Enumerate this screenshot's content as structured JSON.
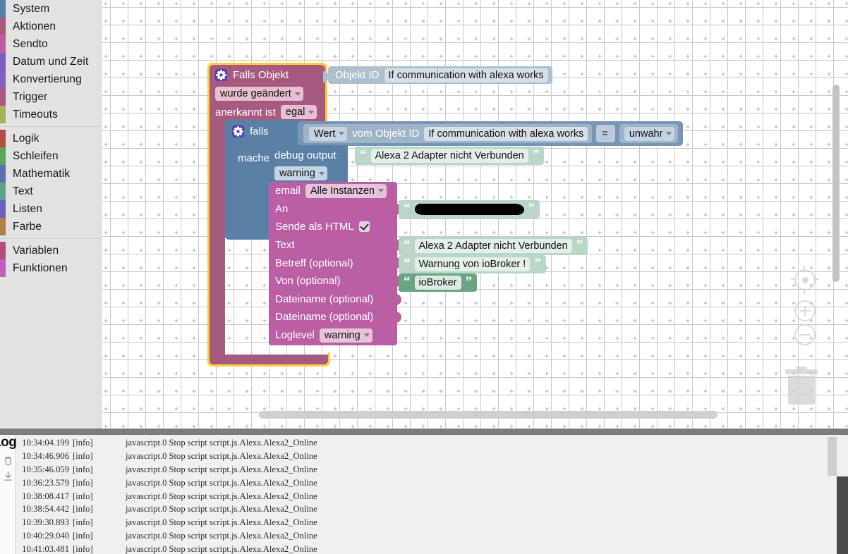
{
  "toolbox": {
    "groups": [
      {
        "items": [
          {
            "label": "System",
            "color": "#5b80a5"
          },
          {
            "label": "Aktionen",
            "color": "#a75a7f"
          },
          {
            "label": "Sendto",
            "color": "#ba5fa3"
          },
          {
            "label": "Datum und Zeit",
            "color": "#7d5fc0"
          },
          {
            "label": "Konvertierung",
            "color": "#8a5fc0"
          },
          {
            "label": "Trigger",
            "color": "#a75a7f"
          },
          {
            "label": "Timeouts",
            "color": "#a8b05a"
          }
        ]
      },
      {
        "items": [
          {
            "label": "Logik",
            "color": "#b04f44"
          },
          {
            "label": "Schleifen",
            "color": "#5ba55b"
          },
          {
            "label": "Mathematik",
            "color": "#5a72b0"
          },
          {
            "label": "Text",
            "color": "#5ba58d"
          },
          {
            "label": "Listen",
            "color": "#6b5fc0"
          },
          {
            "label": "Farbe",
            "color": "#b07f4a"
          }
        ]
      },
      {
        "items": [
          {
            "label": "Variablen",
            "color": "#b0507f"
          },
          {
            "label": "Funktionen",
            "color": "#c05fc0"
          }
        ]
      }
    ]
  },
  "workspace": {
    "selected_block": "trigger-block",
    "trigger": {
      "title": "Falls Objekt",
      "change_mode": "wurde geändert",
      "ack_label": "anerkannt ist",
      "ack_value": "egal",
      "object_id_label": "Objekt ID",
      "object_id_value": "If communication with alexa works",
      "color": "#a75a7f"
    },
    "if_block": {
      "title": "falls",
      "do_label": "mache",
      "color": "#5b80a5",
      "condition": {
        "value_selector": "Wert",
        "from_object_label": "vom Objekt ID",
        "object_id_value": "If communication with alexa works",
        "operator": "=",
        "compare_to": "unwahr"
      }
    },
    "debug_block": {
      "label": "debug output",
      "level": "warning",
      "message": "Alexa 2 Adapter nicht Verbunden",
      "color": "#5b80a5"
    },
    "email_block": {
      "color": "#ba5fa3",
      "title": "email",
      "instance": "Alle Instanzen",
      "rows": [
        {
          "label": "An",
          "value": "",
          "redacted": true
        },
        {
          "label": "Sende als HTML",
          "checkbox": true
        },
        {
          "label": "Text",
          "value": "Alexa 2 Adapter nicht Verbunden"
        },
        {
          "label": "Betreff (optional)",
          "value": "Warnung von ioBroker !"
        },
        {
          "label": "Von (optional)",
          "value": "ioBroker",
          "dark": true
        },
        {
          "label": "Dateiname (optional)",
          "value": ""
        },
        {
          "label": "Dateiname (optional)",
          "value": ""
        }
      ],
      "loglevel_label": "Loglevel",
      "loglevel_value": "warning"
    },
    "controls": {
      "center": "center-target-icon",
      "zoom_in": "zoom-in-icon",
      "zoom_out": "zoom-out-icon",
      "trash": "trash-icon"
    }
  },
  "log": {
    "title": "Log",
    "clear_icon": "trash-icon",
    "download_icon": "download-icon",
    "entries": [
      {
        "time": "10:34:04.199",
        "severity": "[info]",
        "message": "javascript.0 Stop script script.js.Alexa.Alexa2_Online"
      },
      {
        "time": "10:34:46.906",
        "severity": "[info]",
        "message": "javascript.0 Stop script script.js.Alexa.Alexa2_Online"
      },
      {
        "time": "10:35:46.059",
        "severity": "[info]",
        "message": "javascript.0 Stop script script.js.Alexa.Alexa2_Online"
      },
      {
        "time": "10:36:23.579",
        "severity": "[info]",
        "message": "javascript.0 Stop script script.js.Alexa.Alexa2_Online"
      },
      {
        "time": "10:38:08.417",
        "severity": "[info]",
        "message": "javascript.0 Stop script script.js.Alexa.Alexa2_Online"
      },
      {
        "time": "10:38:54.442",
        "severity": "[info]",
        "message": "javascript.0 Stop script script.js.Alexa.Alexa2_Online"
      },
      {
        "time": "10:39:30.893",
        "severity": "[info]",
        "message": "javascript.0 Stop script script.js.Alexa.Alexa2_Online"
      },
      {
        "time": "10:40:29.040",
        "severity": "[info]",
        "message": "javascript.0 Stop script script.js.Alexa.Alexa2_Online"
      },
      {
        "time": "10:41:03.481",
        "severity": "[info]",
        "message": "javascript.0 Stop script script.js.Alexa.Alexa2_Online"
      }
    ]
  }
}
